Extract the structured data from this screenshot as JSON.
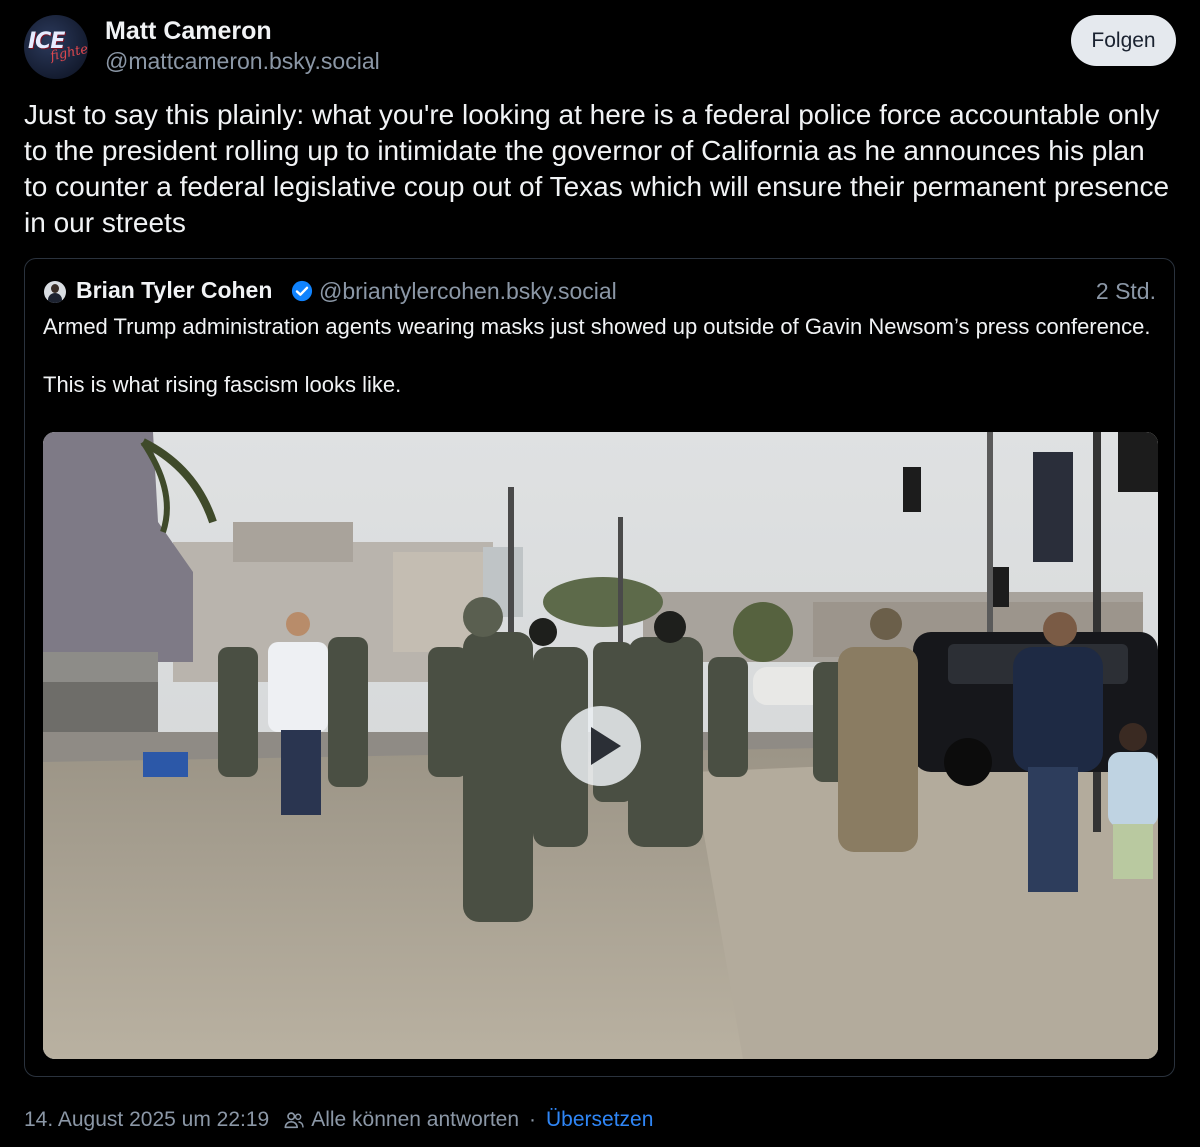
{
  "author": {
    "name": "Matt Cameron",
    "handle": "@mattcameron.bsky.social",
    "avatar_icon": "ice-fighter-logo"
  },
  "follow_button": {
    "label": "Folgen"
  },
  "post": {
    "text": "Just to say this plainly: what you're looking at here is a federal police force accountable only to the president rolling up to intimidate the governor of California as he announces his plan to counter a federal legislative coup out of Texas which will ensure their permanent presence in our streets"
  },
  "quote": {
    "author_name": "Brian Tyler Cohen",
    "handle": "@briantylercohen.bsky.social",
    "time": "2 Std.",
    "text_line1": "Armed Trump administration agents wearing masks just showed up outside of Gavin Newsom’s press conference.",
    "text_line2": "This is what rising fascism looks like.",
    "verified_color": "#1083fe",
    "video": {
      "play_icon": "play-icon"
    }
  },
  "footer": {
    "timestamp": "14. August 2025 um 22:19",
    "reply_setting": "Alle können antworten",
    "separator": "·",
    "translate": "Übersetzen"
  },
  "colors": {
    "background": "#000000",
    "text": "#f1f3f5",
    "muted": "#8b97a6",
    "link": "#2f86f6",
    "border": "#2a323d"
  }
}
